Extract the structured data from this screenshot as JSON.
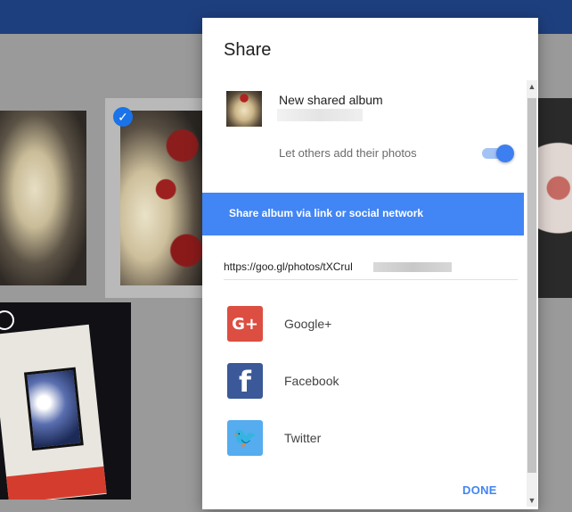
{
  "dialog": {
    "title": "Share",
    "album": {
      "name": "New shared album",
      "let_others_label": "Let others add their photos",
      "toggle_on": true
    },
    "share_banner": "Share album via link or social network",
    "link": "https://goo.gl/photos/tXCrul",
    "social": [
      {
        "label": "Google+",
        "icon": "google-plus-icon",
        "icon_text": "G+",
        "color": "#dc4e41"
      },
      {
        "label": "Facebook",
        "icon": "facebook-icon",
        "icon_text": "f",
        "color": "#3b5998"
      },
      {
        "label": "Twitter",
        "icon": "twitter-icon",
        "icon_text": "🐦",
        "color": "#55acee"
      }
    ],
    "done_label": "DONE"
  },
  "colors": {
    "accent": "#4285f4",
    "topbar": "#1e3f7e"
  }
}
